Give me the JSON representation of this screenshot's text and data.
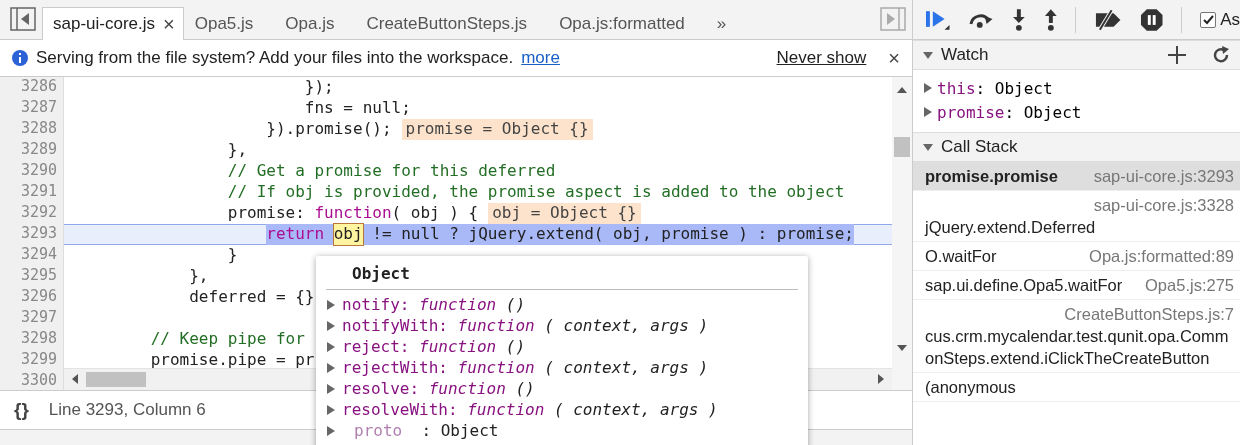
{
  "editor": {
    "tabs": [
      {
        "label": "sap-ui-core.js",
        "selected": true,
        "close": "×"
      },
      {
        "label": "Opa5.js",
        "selected": false
      },
      {
        "label": "Opa.js",
        "selected": false
      },
      {
        "label": "CreateButtonSteps.js",
        "selected": false
      },
      {
        "label": "Opa.js:formatted",
        "selected": false
      }
    ],
    "more_tabs": "»",
    "infobar": {
      "message": "Serving from the file system? Add your files into the workspace.",
      "link": "more",
      "dismiss": "Never show",
      "close": "×"
    },
    "lines": [
      {
        "number": "3286",
        "tokens": [
          {
            "kind": "plain",
            "text": "                         });"
          }
        ]
      },
      {
        "number": "3287",
        "tokens": [
          {
            "kind": "plain",
            "text": "                         fns = null;"
          }
        ]
      },
      {
        "number": "3288",
        "tokens": [
          {
            "kind": "plain",
            "text": "                     }).promise();"
          }
        ],
        "annotation": "promise = Object {}"
      },
      {
        "number": "3289",
        "tokens": [
          {
            "kind": "plain",
            "text": "                 },"
          }
        ]
      },
      {
        "number": "3290",
        "tokens": [
          {
            "kind": "comment",
            "text": "                 // Get a promise for this deferred"
          }
        ]
      },
      {
        "number": "3291",
        "tokens": [
          {
            "kind": "comment",
            "text": "                 // If obj is provided, the promise aspect is added to the object"
          }
        ]
      },
      {
        "number": "3292",
        "tokens": [
          {
            "kind": "plain",
            "text": "                 promise: "
          },
          {
            "kind": "keyword",
            "text": "function"
          },
          {
            "kind": "plain",
            "text": "( obj ) {"
          }
        ],
        "annotation": "obj = Object {}"
      },
      {
        "number": "3293",
        "current": true,
        "tokens": [
          {
            "kind": "keyword",
            "text": "                     return"
          },
          {
            "kind": "hover",
            "text": "obj"
          },
          {
            "kind": "plain",
            "text": " != null ? jQuery.extend( obj, promise ) : promise;"
          }
        ]
      },
      {
        "number": "3294",
        "tokens": [
          {
            "kind": "plain",
            "text": "                 }"
          }
        ]
      },
      {
        "number": "3295",
        "tokens": [
          {
            "kind": "plain",
            "text": "             },"
          }
        ]
      },
      {
        "number": "3296",
        "tokens": [
          {
            "kind": "plain",
            "text": "             deferred = {}"
          }
        ]
      },
      {
        "number": "3297"
      },
      {
        "number": "3298",
        "tokens": [
          {
            "kind": "comment",
            "text": "         // Keep pipe for"
          }
        ]
      },
      {
        "number": "3299",
        "tokens": [
          {
            "kind": "plain",
            "text": "         promise.pipe = pr"
          }
        ]
      },
      {
        "number": "3300"
      }
    ],
    "popover": {
      "title": "Object",
      "properties": [
        {
          "kind": "method",
          "name": "notify:",
          "type": "function",
          "signature": "()"
        },
        {
          "kind": "method",
          "name": "notifyWith:",
          "type": "function",
          "signature": "( context, args )"
        },
        {
          "kind": "method",
          "name": "reject:",
          "type": "function",
          "signature": "()"
        },
        {
          "kind": "method",
          "name": "rejectWith:",
          "type": "function",
          "signature": "( context, args )"
        },
        {
          "kind": "method",
          "name": "resolve:",
          "type": "function",
          "signature": "()"
        },
        {
          "kind": "method",
          "name": "resolveWith:",
          "type": "function",
          "signature": "( context, args )"
        },
        {
          "kind": "property",
          "name": "proto",
          "value": ": Object"
        }
      ]
    },
    "status_bar": {
      "format": "{}",
      "position": "Line 3293, Column 6"
    }
  },
  "debugger": {
    "async_checkbox": {
      "label": "As",
      "checked": true
    },
    "watch": {
      "title": "Watch",
      "items": [
        {
          "name": "this",
          "value": ": Object"
        },
        {
          "name": "promise",
          "value": ": Object"
        }
      ]
    },
    "call_stack": {
      "title": "Call Stack",
      "frames": [
        {
          "name": "promise.promise",
          "location": "sap-ui-core.js:3293",
          "selected": true
        },
        {
          "name": "jQuery.extend.Deferred",
          "location": "sap-ui-core.js:3328",
          "selected": false
        },
        {
          "name": "O.waitFor",
          "location": "Opa.js:formatted:89",
          "selected": false
        },
        {
          "name": "sap.ui.define.Opa5.waitFor",
          "location": "Opa5.js:275",
          "selected": false
        },
        {
          "name": "cus.crm.mycalendar.test.qunit.opa.CommonSteps.extend.iClickTheCreateButton",
          "location": "CreateButtonSteps.js:7",
          "selected": false
        },
        {
          "name": "(anonymous",
          "selected": false
        }
      ]
    }
  }
}
